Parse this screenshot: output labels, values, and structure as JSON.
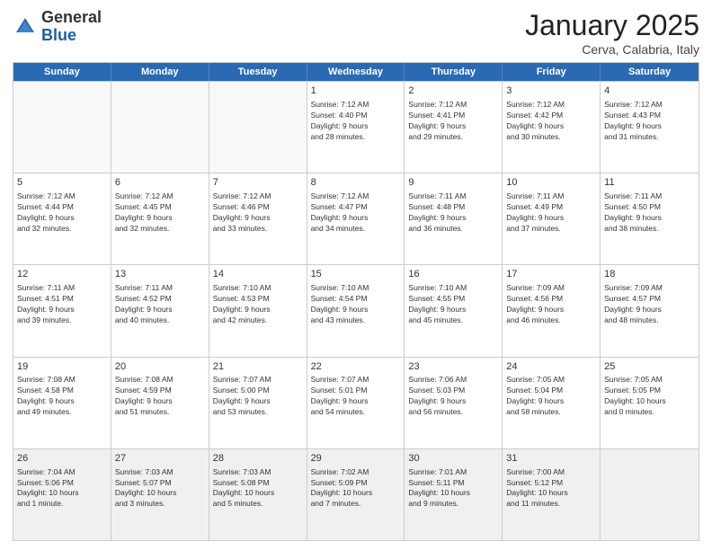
{
  "logo": {
    "general": "General",
    "blue": "Blue"
  },
  "header": {
    "month": "January 2025",
    "location": "Cerva, Calabria, Italy"
  },
  "weekdays": [
    "Sunday",
    "Monday",
    "Tuesday",
    "Wednesday",
    "Thursday",
    "Friday",
    "Saturday"
  ],
  "weeks": [
    [
      {
        "day": "",
        "text": "",
        "empty": true
      },
      {
        "day": "",
        "text": "",
        "empty": true
      },
      {
        "day": "",
        "text": "",
        "empty": true
      },
      {
        "day": "1",
        "text": "Sunrise: 7:12 AM\nSunset: 4:40 PM\nDaylight: 9 hours\nand 28 minutes.",
        "empty": false
      },
      {
        "day": "2",
        "text": "Sunrise: 7:12 AM\nSunset: 4:41 PM\nDaylight: 9 hours\nand 29 minutes.",
        "empty": false
      },
      {
        "day": "3",
        "text": "Sunrise: 7:12 AM\nSunset: 4:42 PM\nDaylight: 9 hours\nand 30 minutes.",
        "empty": false
      },
      {
        "day": "4",
        "text": "Sunrise: 7:12 AM\nSunset: 4:43 PM\nDaylight: 9 hours\nand 31 minutes.",
        "empty": false
      }
    ],
    [
      {
        "day": "5",
        "text": "Sunrise: 7:12 AM\nSunset: 4:44 PM\nDaylight: 9 hours\nand 32 minutes.",
        "empty": false
      },
      {
        "day": "6",
        "text": "Sunrise: 7:12 AM\nSunset: 4:45 PM\nDaylight: 9 hours\nand 32 minutes.",
        "empty": false
      },
      {
        "day": "7",
        "text": "Sunrise: 7:12 AM\nSunset: 4:46 PM\nDaylight: 9 hours\nand 33 minutes.",
        "empty": false
      },
      {
        "day": "8",
        "text": "Sunrise: 7:12 AM\nSunset: 4:47 PM\nDaylight: 9 hours\nand 34 minutes.",
        "empty": false
      },
      {
        "day": "9",
        "text": "Sunrise: 7:11 AM\nSunset: 4:48 PM\nDaylight: 9 hours\nand 36 minutes.",
        "empty": false
      },
      {
        "day": "10",
        "text": "Sunrise: 7:11 AM\nSunset: 4:49 PM\nDaylight: 9 hours\nand 37 minutes.",
        "empty": false
      },
      {
        "day": "11",
        "text": "Sunrise: 7:11 AM\nSunset: 4:50 PM\nDaylight: 9 hours\nand 38 minutes.",
        "empty": false
      }
    ],
    [
      {
        "day": "12",
        "text": "Sunrise: 7:11 AM\nSunset: 4:51 PM\nDaylight: 9 hours\nand 39 minutes.",
        "empty": false
      },
      {
        "day": "13",
        "text": "Sunrise: 7:11 AM\nSunset: 4:52 PM\nDaylight: 9 hours\nand 40 minutes.",
        "empty": false
      },
      {
        "day": "14",
        "text": "Sunrise: 7:10 AM\nSunset: 4:53 PM\nDaylight: 9 hours\nand 42 minutes.",
        "empty": false
      },
      {
        "day": "15",
        "text": "Sunrise: 7:10 AM\nSunset: 4:54 PM\nDaylight: 9 hours\nand 43 minutes.",
        "empty": false
      },
      {
        "day": "16",
        "text": "Sunrise: 7:10 AM\nSunset: 4:55 PM\nDaylight: 9 hours\nand 45 minutes.",
        "empty": false
      },
      {
        "day": "17",
        "text": "Sunrise: 7:09 AM\nSunset: 4:56 PM\nDaylight: 9 hours\nand 46 minutes.",
        "empty": false
      },
      {
        "day": "18",
        "text": "Sunrise: 7:09 AM\nSunset: 4:57 PM\nDaylight: 9 hours\nand 48 minutes.",
        "empty": false
      }
    ],
    [
      {
        "day": "19",
        "text": "Sunrise: 7:08 AM\nSunset: 4:58 PM\nDaylight: 9 hours\nand 49 minutes.",
        "empty": false
      },
      {
        "day": "20",
        "text": "Sunrise: 7:08 AM\nSunset: 4:59 PM\nDaylight: 9 hours\nand 51 minutes.",
        "empty": false
      },
      {
        "day": "21",
        "text": "Sunrise: 7:07 AM\nSunset: 5:00 PM\nDaylight: 9 hours\nand 53 minutes.",
        "empty": false
      },
      {
        "day": "22",
        "text": "Sunrise: 7:07 AM\nSunset: 5:01 PM\nDaylight: 9 hours\nand 54 minutes.",
        "empty": false
      },
      {
        "day": "23",
        "text": "Sunrise: 7:06 AM\nSunset: 5:03 PM\nDaylight: 9 hours\nand 56 minutes.",
        "empty": false
      },
      {
        "day": "24",
        "text": "Sunrise: 7:05 AM\nSunset: 5:04 PM\nDaylight: 9 hours\nand 58 minutes.",
        "empty": false
      },
      {
        "day": "25",
        "text": "Sunrise: 7:05 AM\nSunset: 5:05 PM\nDaylight: 10 hours\nand 0 minutes.",
        "empty": false
      }
    ],
    [
      {
        "day": "26",
        "text": "Sunrise: 7:04 AM\nSunset: 5:06 PM\nDaylight: 10 hours\nand 1 minute.",
        "empty": false,
        "shaded": true
      },
      {
        "day": "27",
        "text": "Sunrise: 7:03 AM\nSunset: 5:07 PM\nDaylight: 10 hours\nand 3 minutes.",
        "empty": false,
        "shaded": true
      },
      {
        "day": "28",
        "text": "Sunrise: 7:03 AM\nSunset: 5:08 PM\nDaylight: 10 hours\nand 5 minutes.",
        "empty": false,
        "shaded": true
      },
      {
        "day": "29",
        "text": "Sunrise: 7:02 AM\nSunset: 5:09 PM\nDaylight: 10 hours\nand 7 minutes.",
        "empty": false,
        "shaded": true
      },
      {
        "day": "30",
        "text": "Sunrise: 7:01 AM\nSunset: 5:11 PM\nDaylight: 10 hours\nand 9 minutes.",
        "empty": false,
        "shaded": true
      },
      {
        "day": "31",
        "text": "Sunrise: 7:00 AM\nSunset: 5:12 PM\nDaylight: 10 hours\nand 11 minutes.",
        "empty": false,
        "shaded": true
      },
      {
        "day": "",
        "text": "",
        "empty": true,
        "shaded": true
      }
    ]
  ]
}
